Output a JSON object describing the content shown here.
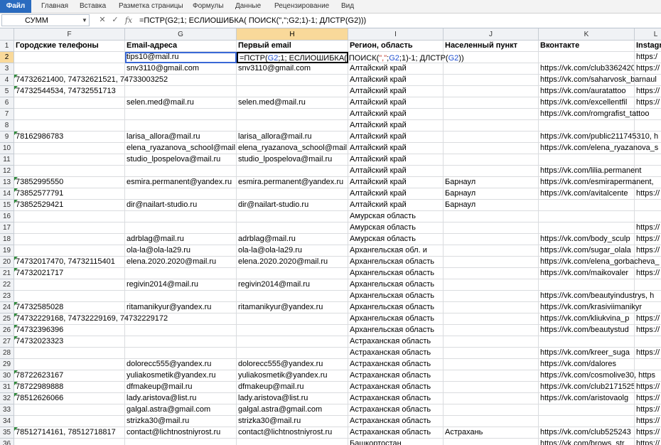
{
  "ribbon": {
    "tabs": [
      "Файл",
      "Главная",
      "Вставка",
      "Разметка страницы",
      "Формулы",
      "Данные",
      "Рецензирование",
      "Вид"
    ]
  },
  "formula_bar": {
    "name_box": "СУММ",
    "cancel_icon": "✕",
    "enter_icon": "✓",
    "fx_label": "fx",
    "formula": "=ПСТР(G2;1; ЕСЛИОШИБКА( ПОИСК(\",\";G2;1)-1; ДЛСТР(G2)))"
  },
  "columns": [
    "F",
    "G",
    "H",
    "I",
    "J",
    "K",
    "L"
  ],
  "headers": [
    "Городские телефоны",
    "Email-адреса",
    "Первый email",
    "Регион, область",
    "Населенный пункт",
    "Вконтакте",
    "Instagr"
  ],
  "editing_formula": {
    "p1": "=ПСТР(",
    "r1": "G2",
    "p2": ";1; ЕСЛИОШИБКА( ПОИСК(",
    "q1": "\",\"",
    "p3": ";",
    "r2": "G2",
    "p4": ";1)-1; ДЛСТР(",
    "r3": "G2",
    "p5": "))"
  },
  "rows": [
    {
      "n": "2",
      "f": "",
      "g": "tips10@mail.ru",
      "h": "",
      "i": "",
      "j": "",
      "k": "",
      "l": "https:/"
    },
    {
      "n": "3",
      "f": "",
      "g": "snv3110@gmail.com",
      "h": "snv3110@gmail.com",
      "i": "Алтайский край",
      "j": "",
      "k": "https://vk.com/club3362420",
      "l": "https://"
    },
    {
      "n": "4",
      "f": "74732621400, 74732621521, 74733003252",
      "g": "",
      "h": "",
      "i": "Алтайский край",
      "j": "",
      "k": "https://vk.com/saharvosk_barnaul",
      "l": "",
      "tri": true
    },
    {
      "n": "5",
      "f": "74732544534, 74732551713",
      "g": "",
      "h": "",
      "i": "Алтайский край",
      "j": "",
      "k": "https://vk.com/auratattoo",
      "l": "https://",
      "tri": true
    },
    {
      "n": "6",
      "f": "",
      "g": "selen.med@mail.ru",
      "h": "selen.med@mail.ru",
      "i": "Алтайский край",
      "j": "",
      "k": "https://vk.com/excellentfil",
      "l": "https://"
    },
    {
      "n": "7",
      "f": "",
      "g": "",
      "h": "",
      "i": "Алтайский край",
      "j": "",
      "k": "https://vk.com/romgrafist_tattoo",
      "l": ""
    },
    {
      "n": "8",
      "f": "",
      "g": "",
      "h": "",
      "i": "Алтайский край",
      "j": "",
      "k": "",
      "l": ""
    },
    {
      "n": "9",
      "f": "78162986783",
      "g": "larisa_allora@mail.ru",
      "h": "larisa_allora@mail.ru",
      "i": "Алтайский край",
      "j": "",
      "k": "https://vk.com/public211745310, h",
      "l": "",
      "tri": true
    },
    {
      "n": "10",
      "f": "",
      "g": "elena_ryazanova_school@mail.",
      "h": "elena_ryazanova_school@mail.",
      "i": "Алтайский край",
      "j": "",
      "k": "https://vk.com/elena_ryazanova_s",
      "l": ""
    },
    {
      "n": "11",
      "f": "",
      "g": "studio_lpospelova@mail.ru",
      "h": "studio_lpospelova@mail.ru",
      "i": "Алтайский край",
      "j": "",
      "k": "",
      "l": ""
    },
    {
      "n": "12",
      "f": "",
      "g": "",
      "h": "",
      "i": "Алтайский край",
      "j": "",
      "k": "https://vk.com/lilia.permanent",
      "l": ""
    },
    {
      "n": "13",
      "f": "73852995550",
      "g": "esmira.permanent@yandex.ru",
      "h": "esmira.permanent@yandex.ru",
      "i": "Алтайский край",
      "j": "Барнаул",
      "k": "https://vk.com/esmirapermanent,",
      "l": "",
      "tri": true
    },
    {
      "n": "14",
      "f": "73852577791",
      "g": "",
      "h": "",
      "i": "Алтайский край",
      "j": "Барнаул",
      "k": "https://vk.com/avitalcente",
      "l": "https://",
      "tri": true
    },
    {
      "n": "15",
      "f": "73852529421",
      "g": "dir@nailart-studio.ru",
      "h": "dir@nailart-studio.ru",
      "i": "Алтайский край",
      "j": "Барнаул",
      "k": "",
      "l": "",
      "tri": true
    },
    {
      "n": "16",
      "f": "",
      "g": "",
      "h": "",
      "i": "Амурская область",
      "j": "",
      "k": "",
      "l": ""
    },
    {
      "n": "17",
      "f": "",
      "g": "",
      "h": "",
      "i": "Амурская область",
      "j": "",
      "k": "",
      "l": "https://"
    },
    {
      "n": "18",
      "f": "",
      "g": "adrblag@mail.ru",
      "h": "adrblag@mail.ru",
      "i": "Амурская область",
      "j": "",
      "k": "https://vk.com/body_sculp",
      "l": "https://"
    },
    {
      "n": "19",
      "f": "",
      "g": "ola-la@ola-la29.ru",
      "h": "ola-la@ola-la29.ru",
      "i": "Архангельская обл. и",
      "j": "",
      "k": "https://vk.com/sugar_olala",
      "l": "https://"
    },
    {
      "n": "20",
      "f": "74732017470, 74732115401",
      "g": "elena.2020.2020@mail.ru",
      "h": "elena.2020.2020@mail.ru",
      "i": "Архангельская область",
      "j": "",
      "k": "https://vk.com/elena_gorbacheva_",
      "l": "",
      "tri": true
    },
    {
      "n": "21",
      "f": "74732021717",
      "g": "",
      "h": "",
      "i": "Архангельская область",
      "j": "",
      "k": "https://vk.com/maikovaler",
      "l": "https://",
      "tri": true
    },
    {
      "n": "22",
      "f": "",
      "g": "regivin2014@mail.ru",
      "h": "regivin2014@mail.ru",
      "i": "Архангельская область",
      "j": "",
      "k": "",
      "l": ""
    },
    {
      "n": "23",
      "f": "",
      "g": "",
      "h": "",
      "i": "Архангельская область",
      "j": "",
      "k": "https://vk.com/beautyindustrys, h",
      "l": ""
    },
    {
      "n": "24",
      "f": "74732585028",
      "g": "ritamanikyur@yandex.ru",
      "h": "ritamanikyur@yandex.ru",
      "i": "Архангельская область",
      "j": "",
      "k": "https://vk.com/krasiviimanikyr",
      "l": "",
      "tri": true
    },
    {
      "n": "25",
      "f": "74732229168, 74732229169, 74732229172",
      "g": "",
      "h": "",
      "i": "Архангельская область",
      "j": "",
      "k": "https://vk.com/kliukvina_p",
      "l": "https://",
      "tri": true
    },
    {
      "n": "26",
      "f": "74732396396",
      "g": "",
      "h": "",
      "i": "Архангельская область",
      "j": "",
      "k": "https://vk.com/beautystud",
      "l": "https://",
      "tri": true
    },
    {
      "n": "27",
      "f": "74732023323",
      "g": "",
      "h": "",
      "i": "Астраханская область",
      "j": "",
      "k": "",
      "l": "",
      "tri": true
    },
    {
      "n": "28",
      "f": "",
      "g": "",
      "h": "",
      "i": "Астраханская область",
      "j": "",
      "k": "https://vk.com/kreer_suga",
      "l": "https://"
    },
    {
      "n": "29",
      "f": "",
      "g": "dolorecc555@yandex.ru",
      "h": "dolorecc555@yandex.ru",
      "i": "Астраханская область",
      "j": "",
      "k": "https://vk.com/dalores",
      "l": ""
    },
    {
      "n": "30",
      "f": "78722623167",
      "g": "yuliakosmetik@yandex.ru",
      "h": "yuliakosmetik@yandex.ru",
      "i": "Астраханская область",
      "j": "",
      "k": "https://vk.com/cosmolive30, https",
      "l": "",
      "tri": true
    },
    {
      "n": "31",
      "f": "78722989888",
      "g": "dfmakeup@mail.ru",
      "h": "dfmakeup@mail.ru",
      "i": "Астраханская область",
      "j": "",
      "k": "https://vk.com/club2171525",
      "l": "https://",
      "tri": true
    },
    {
      "n": "32",
      "f": "78512626066",
      "g": "lady.aristova@list.ru",
      "h": "lady.aristova@list.ru",
      "i": "Астраханская область",
      "j": "",
      "k": "https://vk.com/aristovaolg",
      "l": "https://",
      "tri": true
    },
    {
      "n": "33",
      "f": "",
      "g": "galgal.astra@gmail.com",
      "h": "galgal.astra@gmail.com",
      "i": "Астраханская область",
      "j": "",
      "k": "",
      "l": "https://"
    },
    {
      "n": "34",
      "f": "",
      "g": "strizka30@mail.ru",
      "h": "strizka30@mail.ru",
      "i": "Астраханская область",
      "j": "",
      "k": "",
      "l": "https://"
    },
    {
      "n": "35",
      "f": "78512714161, 78512718817",
      "g": "contact@lichtnostniyrost.ru",
      "h": "contact@lichtnostniyrost.ru",
      "i": "Астраханская область",
      "j": "Астрахань",
      "k": "https://vk.com/club525243",
      "l": "https://",
      "tri": true
    },
    {
      "n": "36",
      "f": "",
      "g": "",
      "h": "",
      "i": "Башкортостан",
      "j": "",
      "k": "https://vk.com/brows_str",
      "l": "https://"
    }
  ]
}
